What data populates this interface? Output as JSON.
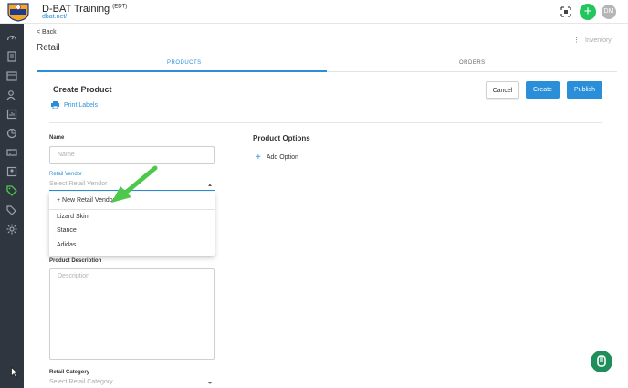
{
  "header": {
    "brand_title": "D-BAT Training",
    "brand_suffix": "(EDT)",
    "brand_url": "dbat.net/",
    "add_label": "+",
    "avatar_initials": "DM",
    "accent_color": "#22c55e"
  },
  "sidebar": {
    "items": [
      {
        "icon": "dashboard-icon"
      },
      {
        "icon": "book-icon"
      },
      {
        "icon": "calendar-icon"
      },
      {
        "icon": "users-icon"
      },
      {
        "icon": "reports-icon"
      },
      {
        "icon": "pie-chart-icon"
      },
      {
        "icon": "ticket-icon"
      },
      {
        "icon": "contacts-icon"
      },
      {
        "icon": "tag-icon",
        "active": true
      },
      {
        "icon": "tags-icon"
      },
      {
        "icon": "settings-icon"
      }
    ]
  },
  "nav": {
    "back_label": "< Back",
    "page_title": "Retail",
    "inventory_label": "Inventory",
    "tabs": [
      "PRODUCTS",
      "ORDERS"
    ]
  },
  "form": {
    "title": "Create Product",
    "print_labels": "Print Labels",
    "cancel_label": "Cancel",
    "create_label": "Create",
    "publish_label": "Publish",
    "name_label": "Name",
    "name_placeholder": "Name",
    "vendor_label": "Retail Vendor",
    "vendor_placeholder": "Select Retail Vendor",
    "vendor_options": [
      "+ New Retail Vendor",
      "Lizard Skin",
      "Stance",
      "Adidas"
    ],
    "description_label": "Product Description",
    "description_placeholder": "Description",
    "category_label": "Retail Category",
    "category_placeholder": "Select Retail Category",
    "options_title": "Product Options",
    "add_option_label": "Add Option"
  },
  "colors": {
    "primary": "#2a8fd8",
    "sidebar_bg": "#2f3640",
    "arrow": "#4cc94a"
  }
}
